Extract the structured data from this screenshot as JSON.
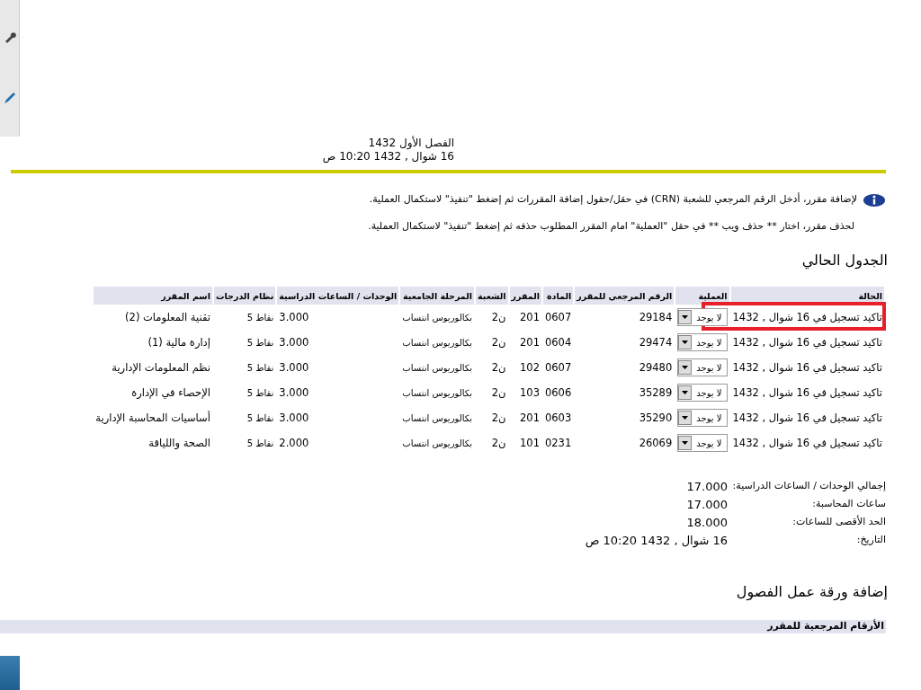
{
  "term": {
    "title": "الفصل الأول 1432",
    "date": "16 شوال , 1432 10:20 ص"
  },
  "info_messages": [
    {
      "kind": "icon",
      "text": "لإضافة مقرر، أدخل الرقم المرجعي للشعبة (CRN) في حقل/حقول إضافة المقررات ثم إضغط \"تنفيذ\" لاستكمال العملية."
    },
    {
      "kind": "plain",
      "text": "لحذف مقرر، اختار ** حذف ويب ** في حقل \"العملية\" امام المقرر المطلوب حذفه ثم إضغط \"تنفيذ\" لاستكمال العملية."
    }
  ],
  "current_schedule": {
    "title": "الجدول الحالي",
    "columns": [
      "الحالة",
      "العملية",
      "الرقم المرجعي للمقرر",
      "المادة",
      "المقرر",
      "الشعبة",
      "المرحلة الجامعية",
      "الوحدات / الساعات الدراسية",
      "نظام الدرجات",
      "اسم المقرر"
    ],
    "rows": [
      {
        "status": "تاكيد تسجيل في 16 شوال , 1432",
        "operation": "لا يوجد",
        "crn": "29184",
        "subject": "0607",
        "course": "201",
        "section": "ن2",
        "level": "بكالوريوس انتساب",
        "units": "3.000",
        "grade_mode": "نقاط 5",
        "title": "تقنية المعلومات (2)",
        "highlighted": true
      },
      {
        "status": "تاكيد تسجيل في 16 شوال , 1432",
        "operation": "لا يوجد",
        "crn": "29474",
        "subject": "0604",
        "course": "201",
        "section": "ن2",
        "level": "بكالوريوس انتساب",
        "units": "3.000",
        "grade_mode": "نقاط 5",
        "title": "إدارة مالية (1)",
        "highlighted": false
      },
      {
        "status": "تاكيد تسجيل في 16 شوال , 1432",
        "operation": "لا يوجد",
        "crn": "29480",
        "subject": "0607",
        "course": "102",
        "section": "ن2",
        "level": "بكالوريوس انتساب",
        "units": "3.000",
        "grade_mode": "نقاط 5",
        "title": "نظم المعلومات الإدارية",
        "highlighted": false
      },
      {
        "status": "تاكيد تسجيل في 16 شوال , 1432",
        "operation": "لا يوجد",
        "crn": "35289",
        "subject": "0606",
        "course": "103",
        "section": "ن2",
        "level": "بكالوريوس انتساب",
        "units": "3.000",
        "grade_mode": "نقاط 5",
        "title": "الإحصاء في الإدارة",
        "highlighted": false
      },
      {
        "status": "تاكيد تسجيل في 16 شوال , 1432",
        "operation": "لا يوجد",
        "crn": "35290",
        "subject": "0603",
        "course": "201",
        "section": "ن2",
        "level": "بكالوريوس انتساب",
        "units": "3.000",
        "grade_mode": "نقاط 5",
        "title": "أساسيات المحاسبة الإدارية",
        "highlighted": false
      },
      {
        "status": "تاكيد تسجيل في 16 شوال , 1432",
        "operation": "لا يوجد",
        "crn": "26069",
        "subject": "0231",
        "course": "101",
        "section": "ن2",
        "level": "بكالوريوس انتساب",
        "units": "2.000",
        "grade_mode": "نقاط 5",
        "title": "الصحة واللياقة",
        "highlighted": false
      }
    ]
  },
  "totals": [
    {
      "label": "إجمالي الوحدات / الساعات الدراسية:",
      "value": "17.000"
    },
    {
      "label": "ساعات المحاسبة:",
      "value": "17.000"
    },
    {
      "label": "الحد الأقصى للساعات:",
      "value": "18.000"
    },
    {
      "label": "التاريخ:",
      "value": "16 شوال , 1432 10:20 ص"
    }
  ],
  "add_worksheet": {
    "title": "إضافة ورقة عمل الفصول",
    "column_header": "الأرقام المرجعية للمقرر"
  }
}
